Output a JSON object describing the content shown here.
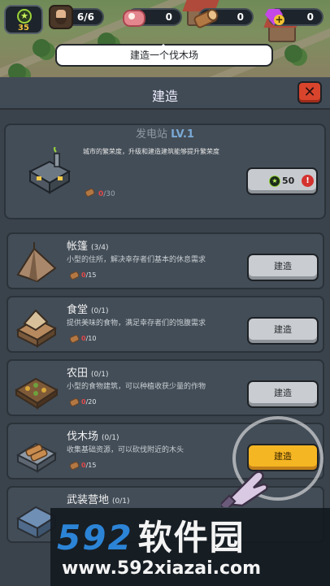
{
  "hud": {
    "level": "35",
    "survivors": "6/6",
    "meat": "0",
    "wood": "0",
    "gems": "0"
  },
  "tooltip": "建造一个伐木场",
  "panel": {
    "title": "建造",
    "close_label": "✕"
  },
  "featured": {
    "name": "发电站",
    "level": "LV.1",
    "desc": "城市的繁荣度，升级和建造建筑能够提升繁荣度",
    "cost_have": "0",
    "cost_need": "/30",
    "button_value": "50",
    "warn": "!"
  },
  "buildings": [
    {
      "name": "帐篷",
      "count": "(3/4)",
      "desc": "小型的住所，解决幸存者们基本的休息需求",
      "cost_have": "0",
      "cost_need": "/15",
      "button": "建造",
      "active": false
    },
    {
      "name": "食堂",
      "count": "(0/1)",
      "desc": "提供美味的食物，满足幸存者们的饱腹需求",
      "cost_have": "0",
      "cost_need": "/10",
      "button": "建造",
      "active": false
    },
    {
      "name": "农田",
      "count": "(0/1)",
      "desc": "小型的食物建筑，可以种植收获少量的作物",
      "cost_have": "0",
      "cost_need": "/20",
      "button": "建造",
      "active": false
    },
    {
      "name": "伐木场",
      "count": "(0/1)",
      "desc": "收集基础资源，可以砍伐附近的木头",
      "cost_have": "0",
      "cost_need": "/15",
      "button": "建造",
      "active": true
    },
    {
      "name": "武装营地",
      "count": "(0/1)",
      "desc": "",
      "cost_have": "",
      "cost_need": "",
      "button": "",
      "active": false
    }
  ],
  "watermark": {
    "brand_num": "592",
    "brand_cn": "软件园",
    "url": "www.592xiazai.com"
  },
  "colors": {
    "active_button": "#f5b623",
    "close_button": "#d9452c",
    "level_accent": "#7aa9d6"
  }
}
